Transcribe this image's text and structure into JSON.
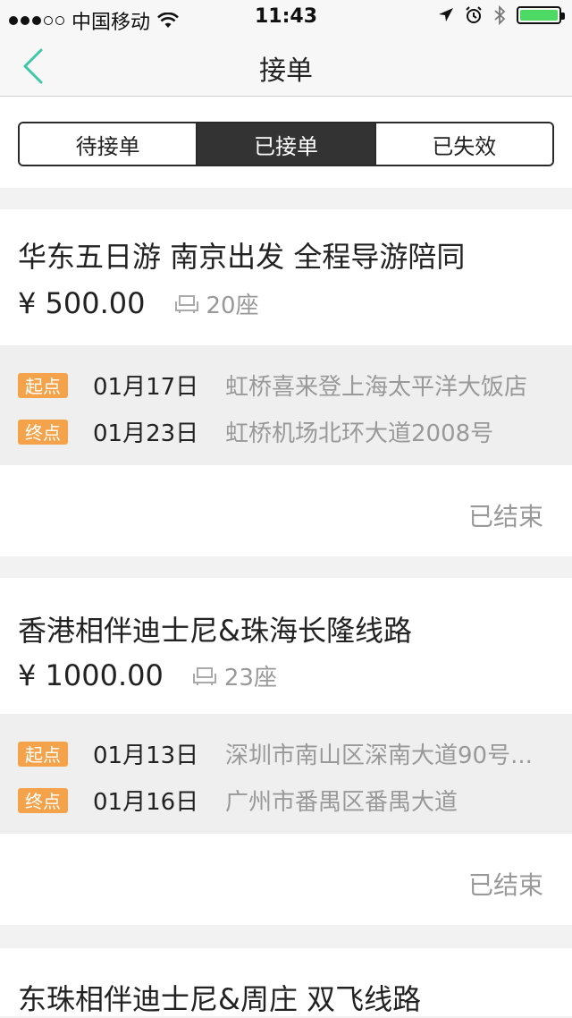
{
  "status_bar": {
    "carrier": "中国移动",
    "time": "11:43"
  },
  "nav": {
    "title": "接单",
    "back_icon": "chevron-left-icon",
    "accent": "#3dc8a7"
  },
  "tabs": [
    {
      "label": "待接单",
      "active": false
    },
    {
      "label": "已接单",
      "active": true
    },
    {
      "label": "已失效",
      "active": false
    }
  ],
  "orders": [
    {
      "title": "华东五日游 南京出发 全程导游陪同",
      "price": "¥ 500.00",
      "seats": "20座",
      "start": {
        "tag": "起点",
        "date": "01月17日",
        "address": "虹桥喜来登上海太平洋大饭店"
      },
      "end": {
        "tag": "终点",
        "date": "01月23日",
        "address": "虹桥机场北环大道2008号"
      },
      "status": "已结束"
    },
    {
      "title": "香港相伴迪士尼&珠海长隆线路",
      "price": "¥ 1000.00",
      "seats": "23座",
      "start": {
        "tag": "起点",
        "date": "01月13日",
        "address": "深圳市南山区深南大道90号..."
      },
      "end": {
        "tag": "终点",
        "date": "01月16日",
        "address": "广州市番禺区番禺大道"
      },
      "status": "已结束"
    },
    {
      "title": "东珠相伴迪士尼&周庄 双飞线路"
    }
  ],
  "colors": {
    "tag_orange": "#f5a34a",
    "battery_green": "#4cd964"
  }
}
